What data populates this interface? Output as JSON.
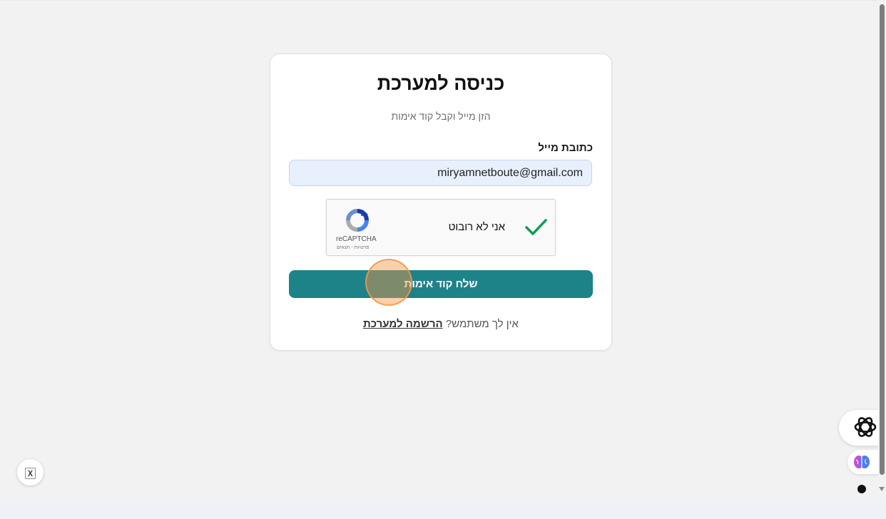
{
  "login": {
    "title": "כניסה למערכת",
    "subtitle": "הזן מייל וקבל קוד אימות",
    "email_label": "כתובת מייל",
    "email_value": "miryamnetboute@gmail.com",
    "submit_label": "שלח קוד אימות",
    "no_user_text": "אין לך משתמש?",
    "register_link": "הרשמה למערכת"
  },
  "captcha": {
    "label": "אני לא רובוט",
    "brand": "reCAPTCHA",
    "links": "פרטיות - תנאים",
    "checked": true
  },
  "icons": {
    "accessibility": "accessibility-icon",
    "assistant": "openai-icon",
    "brain": "brain-icon"
  },
  "colors": {
    "primary": "#1e8289",
    "check": "#0f9d58"
  }
}
